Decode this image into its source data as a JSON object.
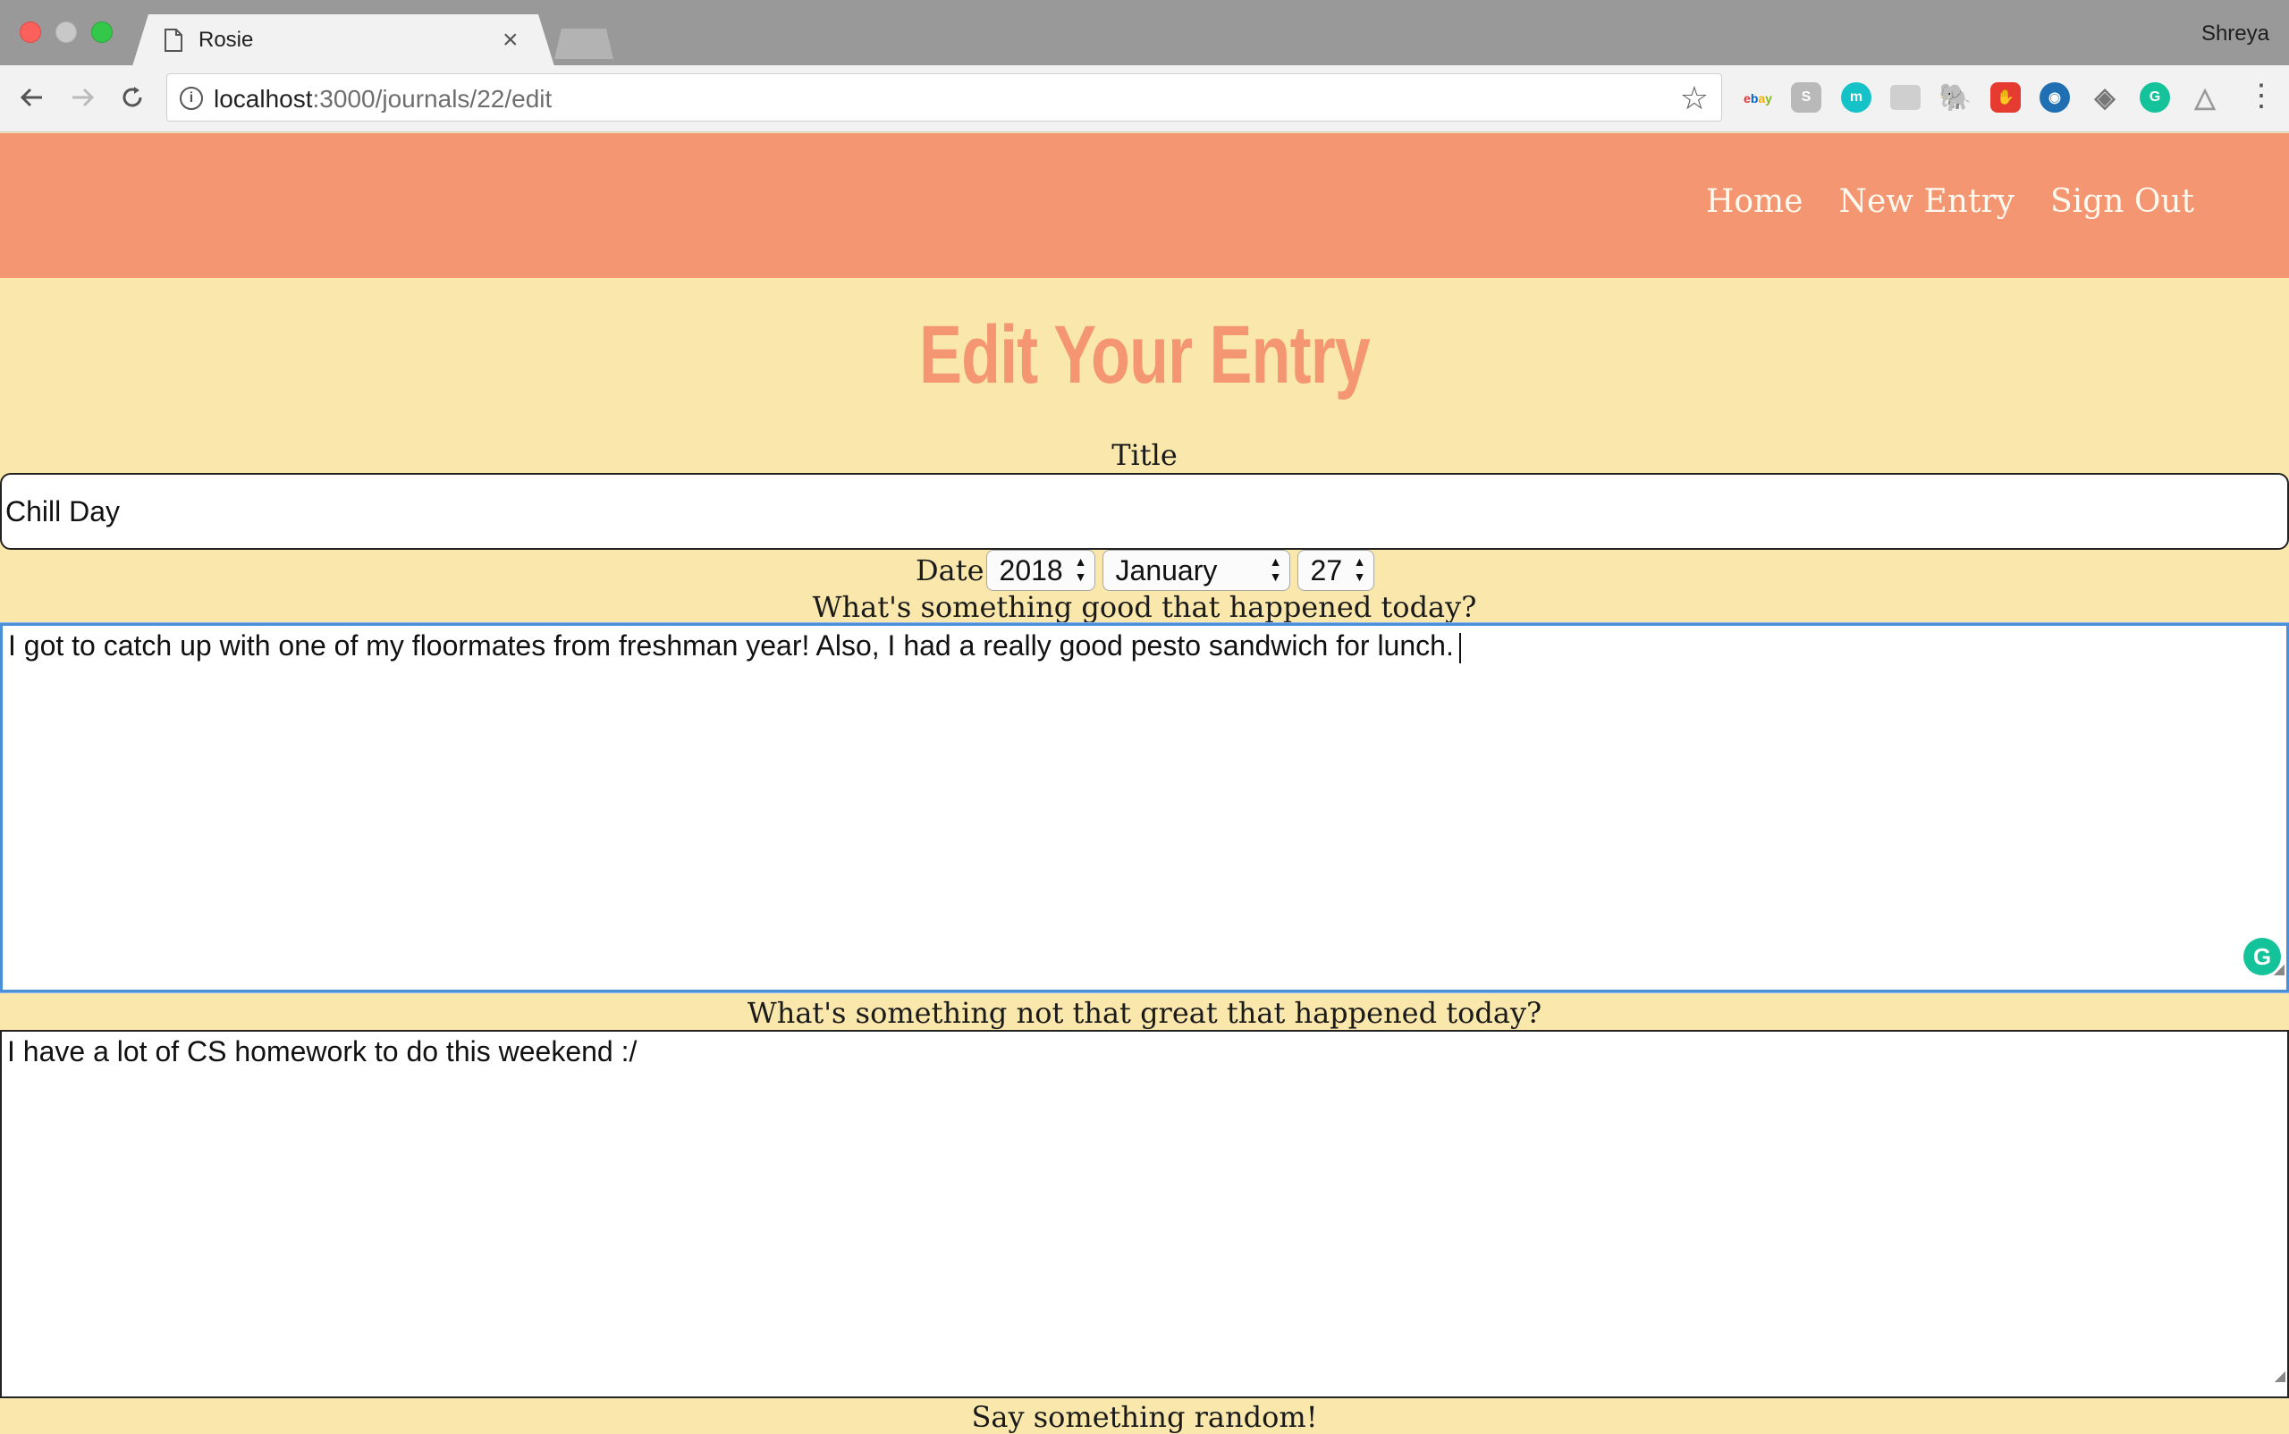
{
  "browser": {
    "tab_title": "Rosie",
    "tab_close": "×",
    "profile_name": "Shreya",
    "url_host": "localhost",
    "url_path": ":3000/journals/22/edit",
    "extensions": [
      "ebay",
      "S",
      "m",
      "",
      "",
      "",
      "",
      "",
      "G",
      ""
    ]
  },
  "nav": {
    "home": "Home",
    "new_entry": "New Entry",
    "sign_out": "Sign Out"
  },
  "page": {
    "title": "Edit Your Entry"
  },
  "form": {
    "title_label": "Title",
    "title_value": "Chill Day",
    "date_label": "Date",
    "year": "2018",
    "month": "January",
    "day": "27",
    "good_label": "What's something good that happened today?",
    "good_value": "I got to catch up with one of my floormates from freshman year! Also, I had a really good pesto sandwich for lunch.",
    "bad_label": "What's something not that great that happened today?",
    "bad_value": "I have a lot of CS homework to do this weekend :/",
    "random_label": "Say something random!"
  },
  "colors": {
    "header_bg": "#f49671",
    "page_bg": "#f9e7ab",
    "title_color": "#f49671"
  }
}
